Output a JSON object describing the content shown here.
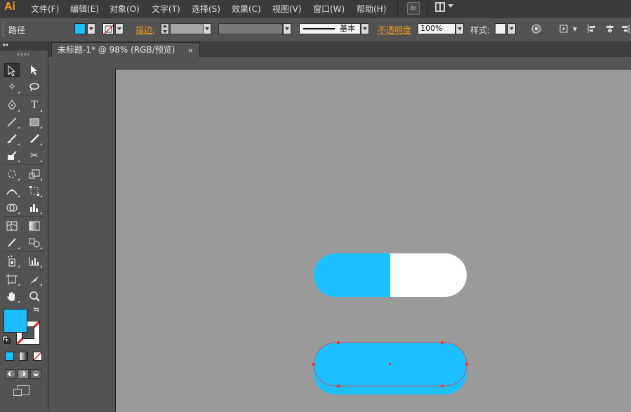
{
  "app": {
    "logo": "Ai"
  },
  "menu": {
    "items": [
      "文件(F)",
      "编辑(E)",
      "对象(O)",
      "文字(T)",
      "选择(S)",
      "效果(C)",
      "视图(V)",
      "窗口(W)",
      "帮助(H)"
    ],
    "bridge_label": "Br"
  },
  "control_bar": {
    "selection_label": "路径",
    "fill_color": "#1dc0ff",
    "stroke_label": "描边:",
    "brush_label": "基本",
    "opacity_label": "不透明度",
    "opacity_value": "100%",
    "style_label": "样式:"
  },
  "document": {
    "tab_title": "未标题-1* @ 98% (RGB/预览)",
    "close_glyph": "×"
  },
  "toolbar": {
    "collapse_glyph": "◂◂",
    "fill_color": "#1dc0ff",
    "stroke_color": "none"
  },
  "artwork": {
    "accent_color": "#1dc0ff",
    "pill_right_color": "#ffffff",
    "anchor_color": "#e83a3a"
  }
}
